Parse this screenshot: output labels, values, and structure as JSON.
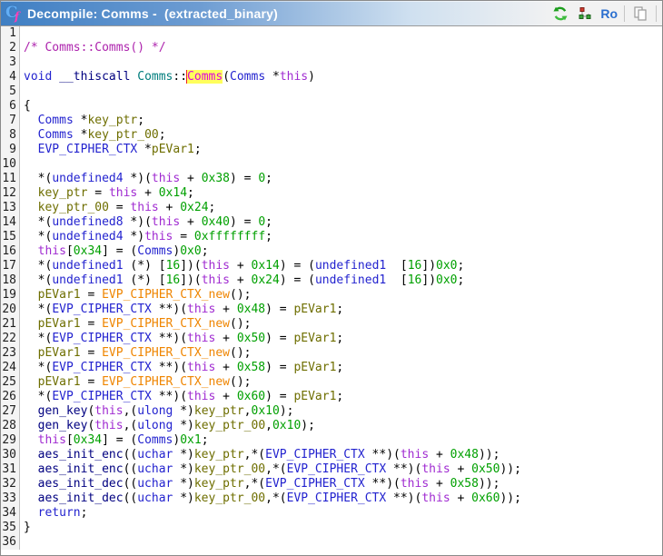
{
  "window": {
    "title": "Decompile: Comms -  (extracted_binary)",
    "icon": {
      "letter_main": "C",
      "letter_sub": "f"
    },
    "toolbar": {
      "ro_label": "Ro"
    }
  },
  "colors": {
    "titlebar_from": "#3f7fc3",
    "titlebar_to": "#f2f2f2",
    "titlebar_text": "#ffffff",
    "keyword": "#2323cf",
    "navy": "#000080",
    "variable": "#6e6e00",
    "parameter": "#a02bd1",
    "constant": "#00a000",
    "comment": "#ad23ad",
    "namespace": "#007d7d",
    "function_extern": "#ef8500",
    "highlight_text": "#dd00dd",
    "highlight_bg": "#ffff5c",
    "caret": "#ee2222",
    "line_number": "#1f1f1f",
    "gutter_bg": "#f4f4f4",
    "gutter_border": "#c0c0c0"
  },
  "code": {
    "lines": [
      {
        "n": 1,
        "t": []
      },
      {
        "n": 2,
        "t": [
          [
            "m",
            "/* Comms::Comms() */"
          ]
        ]
      },
      {
        "n": 3,
        "t": []
      },
      {
        "n": 4,
        "t": [
          [
            "k",
            "void"
          ],
          [
            "p",
            " "
          ],
          [
            "d",
            "__thiscall"
          ],
          [
            "p",
            " "
          ],
          [
            "s",
            "Comms"
          ],
          [
            "p",
            "::"
          ],
          [
            "x",
            ""
          ],
          [
            "h",
            "Comms"
          ],
          [
            "p",
            "("
          ],
          [
            "k",
            "Comms"
          ],
          [
            "p",
            " *"
          ],
          [
            "t",
            "this"
          ],
          [
            "p",
            ")"
          ]
        ]
      },
      {
        "n": 5,
        "t": []
      },
      {
        "n": 6,
        "t": [
          [
            "p",
            "{"
          ]
        ]
      },
      {
        "n": 7,
        "t": [
          [
            "p",
            "  "
          ],
          [
            "k",
            "Comms"
          ],
          [
            "p",
            " *"
          ],
          [
            "v",
            "key_ptr"
          ],
          [
            "p",
            ";"
          ]
        ]
      },
      {
        "n": 8,
        "t": [
          [
            "p",
            "  "
          ],
          [
            "k",
            "Comms"
          ],
          [
            "p",
            " *"
          ],
          [
            "v",
            "key_ptr_00"
          ],
          [
            "p",
            ";"
          ]
        ]
      },
      {
        "n": 9,
        "t": [
          [
            "p",
            "  "
          ],
          [
            "k",
            "EVP_CIPHER_CTX"
          ],
          [
            "p",
            " *"
          ],
          [
            "v",
            "pEVar1"
          ],
          [
            "p",
            ";"
          ]
        ]
      },
      {
        "n": 10,
        "t": []
      },
      {
        "n": 11,
        "t": [
          [
            "p",
            "  *("
          ],
          [
            "k",
            "undefined4"
          ],
          [
            "p",
            " *)("
          ],
          [
            "t",
            "this"
          ],
          [
            "p",
            " + "
          ],
          [
            "c",
            "0x38"
          ],
          [
            "p",
            ") = "
          ],
          [
            "c",
            "0"
          ],
          [
            "p",
            ";"
          ]
        ]
      },
      {
        "n": 12,
        "t": [
          [
            "p",
            "  "
          ],
          [
            "v",
            "key_ptr"
          ],
          [
            "p",
            " = "
          ],
          [
            "t",
            "this"
          ],
          [
            "p",
            " + "
          ],
          [
            "c",
            "0x14"
          ],
          [
            "p",
            ";"
          ]
        ]
      },
      {
        "n": 13,
        "t": [
          [
            "p",
            "  "
          ],
          [
            "v",
            "key_ptr_00"
          ],
          [
            "p",
            " = "
          ],
          [
            "t",
            "this"
          ],
          [
            "p",
            " + "
          ],
          [
            "c",
            "0x24"
          ],
          [
            "p",
            ";"
          ]
        ]
      },
      {
        "n": 14,
        "t": [
          [
            "p",
            "  *("
          ],
          [
            "k",
            "undefined8"
          ],
          [
            "p",
            " *)("
          ],
          [
            "t",
            "this"
          ],
          [
            "p",
            " + "
          ],
          [
            "c",
            "0x40"
          ],
          [
            "p",
            ") = "
          ],
          [
            "c",
            "0"
          ],
          [
            "p",
            ";"
          ]
        ]
      },
      {
        "n": 15,
        "t": [
          [
            "p",
            "  *("
          ],
          [
            "k",
            "undefined4"
          ],
          [
            "p",
            " *)"
          ],
          [
            "t",
            "this"
          ],
          [
            "p",
            " = "
          ],
          [
            "c",
            "0xffffffff"
          ],
          [
            "p",
            ";"
          ]
        ]
      },
      {
        "n": 16,
        "t": [
          [
            "p",
            "  "
          ],
          [
            "t",
            "this"
          ],
          [
            "p",
            "["
          ],
          [
            "c",
            "0x34"
          ],
          [
            "p",
            "] = ("
          ],
          [
            "k",
            "Comms"
          ],
          [
            "p",
            ")"
          ],
          [
            "c",
            "0x0"
          ],
          [
            "p",
            ";"
          ]
        ]
      },
      {
        "n": 17,
        "t": [
          [
            "p",
            "  *("
          ],
          [
            "k",
            "undefined1"
          ],
          [
            "p",
            " (*) ["
          ],
          [
            "c",
            "16"
          ],
          [
            "p",
            "])("
          ],
          [
            "t",
            "this"
          ],
          [
            "p",
            " + "
          ],
          [
            "c",
            "0x14"
          ],
          [
            "p",
            ") = ("
          ],
          [
            "k",
            "undefined1"
          ],
          [
            "p",
            "  ["
          ],
          [
            "c",
            "16"
          ],
          [
            "p",
            "])"
          ],
          [
            "c",
            "0x0"
          ],
          [
            "p",
            ";"
          ]
        ]
      },
      {
        "n": 18,
        "t": [
          [
            "p",
            "  *("
          ],
          [
            "k",
            "undefined1"
          ],
          [
            "p",
            " (*) ["
          ],
          [
            "c",
            "16"
          ],
          [
            "p",
            "])("
          ],
          [
            "t",
            "this"
          ],
          [
            "p",
            " + "
          ],
          [
            "c",
            "0x24"
          ],
          [
            "p",
            ") = ("
          ],
          [
            "k",
            "undefined1"
          ],
          [
            "p",
            "  ["
          ],
          [
            "c",
            "16"
          ],
          [
            "p",
            "])"
          ],
          [
            "c",
            "0x0"
          ],
          [
            "p",
            ";"
          ]
        ]
      },
      {
        "n": 19,
        "t": [
          [
            "p",
            "  "
          ],
          [
            "v",
            "pEVar1"
          ],
          [
            "p",
            " = "
          ],
          [
            "f",
            "EVP_CIPHER_CTX_new"
          ],
          [
            "p",
            "();"
          ]
        ]
      },
      {
        "n": 20,
        "t": [
          [
            "p",
            "  *("
          ],
          [
            "k",
            "EVP_CIPHER_CTX"
          ],
          [
            "p",
            " **)("
          ],
          [
            "t",
            "this"
          ],
          [
            "p",
            " + "
          ],
          [
            "c",
            "0x48"
          ],
          [
            "p",
            ") = "
          ],
          [
            "v",
            "pEVar1"
          ],
          [
            "p",
            ";"
          ]
        ]
      },
      {
        "n": 21,
        "t": [
          [
            "p",
            "  "
          ],
          [
            "v",
            "pEVar1"
          ],
          [
            "p",
            " = "
          ],
          [
            "f",
            "EVP_CIPHER_CTX_new"
          ],
          [
            "p",
            "();"
          ]
        ]
      },
      {
        "n": 22,
        "t": [
          [
            "p",
            "  *("
          ],
          [
            "k",
            "EVP_CIPHER_CTX"
          ],
          [
            "p",
            " **)("
          ],
          [
            "t",
            "this"
          ],
          [
            "p",
            " + "
          ],
          [
            "c",
            "0x50"
          ],
          [
            "p",
            ") = "
          ],
          [
            "v",
            "pEVar1"
          ],
          [
            "p",
            ";"
          ]
        ]
      },
      {
        "n": 23,
        "t": [
          [
            "p",
            "  "
          ],
          [
            "v",
            "pEVar1"
          ],
          [
            "p",
            " = "
          ],
          [
            "f",
            "EVP_CIPHER_CTX_new"
          ],
          [
            "p",
            "();"
          ]
        ]
      },
      {
        "n": 24,
        "t": [
          [
            "p",
            "  *("
          ],
          [
            "k",
            "EVP_CIPHER_CTX"
          ],
          [
            "p",
            " **)("
          ],
          [
            "t",
            "this"
          ],
          [
            "p",
            " + "
          ],
          [
            "c",
            "0x58"
          ],
          [
            "p",
            ") = "
          ],
          [
            "v",
            "pEVar1"
          ],
          [
            "p",
            ";"
          ]
        ]
      },
      {
        "n": 25,
        "t": [
          [
            "p",
            "  "
          ],
          [
            "v",
            "pEVar1"
          ],
          [
            "p",
            " = "
          ],
          [
            "f",
            "EVP_CIPHER_CTX_new"
          ],
          [
            "p",
            "();"
          ]
        ]
      },
      {
        "n": 26,
        "t": [
          [
            "p",
            "  *("
          ],
          [
            "k",
            "EVP_CIPHER_CTX"
          ],
          [
            "p",
            " **)("
          ],
          [
            "t",
            "this"
          ],
          [
            "p",
            " + "
          ],
          [
            "c",
            "0x60"
          ],
          [
            "p",
            ") = "
          ],
          [
            "v",
            "pEVar1"
          ],
          [
            "p",
            ";"
          ]
        ]
      },
      {
        "n": 27,
        "t": [
          [
            "p",
            "  "
          ],
          [
            "d",
            "gen_key"
          ],
          [
            "p",
            "("
          ],
          [
            "t",
            "this"
          ],
          [
            "p",
            ",("
          ],
          [
            "k",
            "ulong"
          ],
          [
            "p",
            " *)"
          ],
          [
            "v",
            "key_ptr"
          ],
          [
            "p",
            ","
          ],
          [
            "c",
            "0x10"
          ],
          [
            "p",
            ");"
          ]
        ]
      },
      {
        "n": 28,
        "t": [
          [
            "p",
            "  "
          ],
          [
            "d",
            "gen_key"
          ],
          [
            "p",
            "("
          ],
          [
            "t",
            "this"
          ],
          [
            "p",
            ",("
          ],
          [
            "k",
            "ulong"
          ],
          [
            "p",
            " *)"
          ],
          [
            "v",
            "key_ptr_00"
          ],
          [
            "p",
            ","
          ],
          [
            "c",
            "0x10"
          ],
          [
            "p",
            ");"
          ]
        ]
      },
      {
        "n": 29,
        "t": [
          [
            "p",
            "  "
          ],
          [
            "t",
            "this"
          ],
          [
            "p",
            "["
          ],
          [
            "c",
            "0x34"
          ],
          [
            "p",
            "] = ("
          ],
          [
            "k",
            "Comms"
          ],
          [
            "p",
            ")"
          ],
          [
            "c",
            "0x1"
          ],
          [
            "p",
            ";"
          ]
        ]
      },
      {
        "n": 30,
        "t": [
          [
            "p",
            "  "
          ],
          [
            "d",
            "aes_init_enc"
          ],
          [
            "p",
            "(("
          ],
          [
            "k",
            "uchar"
          ],
          [
            "p",
            " *)"
          ],
          [
            "v",
            "key_ptr"
          ],
          [
            "p",
            ",*("
          ],
          [
            "k",
            "EVP_CIPHER_CTX"
          ],
          [
            "p",
            " **)("
          ],
          [
            "t",
            "this"
          ],
          [
            "p",
            " + "
          ],
          [
            "c",
            "0x48"
          ],
          [
            "p",
            "));"
          ]
        ]
      },
      {
        "n": 31,
        "t": [
          [
            "p",
            "  "
          ],
          [
            "d",
            "aes_init_enc"
          ],
          [
            "p",
            "(("
          ],
          [
            "k",
            "uchar"
          ],
          [
            "p",
            " *)"
          ],
          [
            "v",
            "key_ptr_00"
          ],
          [
            "p",
            ",*("
          ],
          [
            "k",
            "EVP_CIPHER_CTX"
          ],
          [
            "p",
            " **)("
          ],
          [
            "t",
            "this"
          ],
          [
            "p",
            " + "
          ],
          [
            "c",
            "0x50"
          ],
          [
            "p",
            "));"
          ]
        ]
      },
      {
        "n": 32,
        "t": [
          [
            "p",
            "  "
          ],
          [
            "d",
            "aes_init_dec"
          ],
          [
            "p",
            "(("
          ],
          [
            "k",
            "uchar"
          ],
          [
            "p",
            " *)"
          ],
          [
            "v",
            "key_ptr"
          ],
          [
            "p",
            ",*("
          ],
          [
            "k",
            "EVP_CIPHER_CTX"
          ],
          [
            "p",
            " **)("
          ],
          [
            "t",
            "this"
          ],
          [
            "p",
            " + "
          ],
          [
            "c",
            "0x58"
          ],
          [
            "p",
            "));"
          ]
        ]
      },
      {
        "n": 33,
        "t": [
          [
            "p",
            "  "
          ],
          [
            "d",
            "aes_init_dec"
          ],
          [
            "p",
            "(("
          ],
          [
            "k",
            "uchar"
          ],
          [
            "p",
            " *)"
          ],
          [
            "v",
            "key_ptr_00"
          ],
          [
            "p",
            ",*("
          ],
          [
            "k",
            "EVP_CIPHER_CTX"
          ],
          [
            "p",
            " **)("
          ],
          [
            "t",
            "this"
          ],
          [
            "p",
            " + "
          ],
          [
            "c",
            "0x60"
          ],
          [
            "p",
            "));"
          ]
        ]
      },
      {
        "n": 34,
        "t": [
          [
            "p",
            "  "
          ],
          [
            "k",
            "return"
          ],
          [
            "p",
            ";"
          ]
        ]
      },
      {
        "n": 35,
        "t": [
          [
            "p",
            "}"
          ]
        ]
      },
      {
        "n": 36,
        "t": []
      }
    ]
  }
}
